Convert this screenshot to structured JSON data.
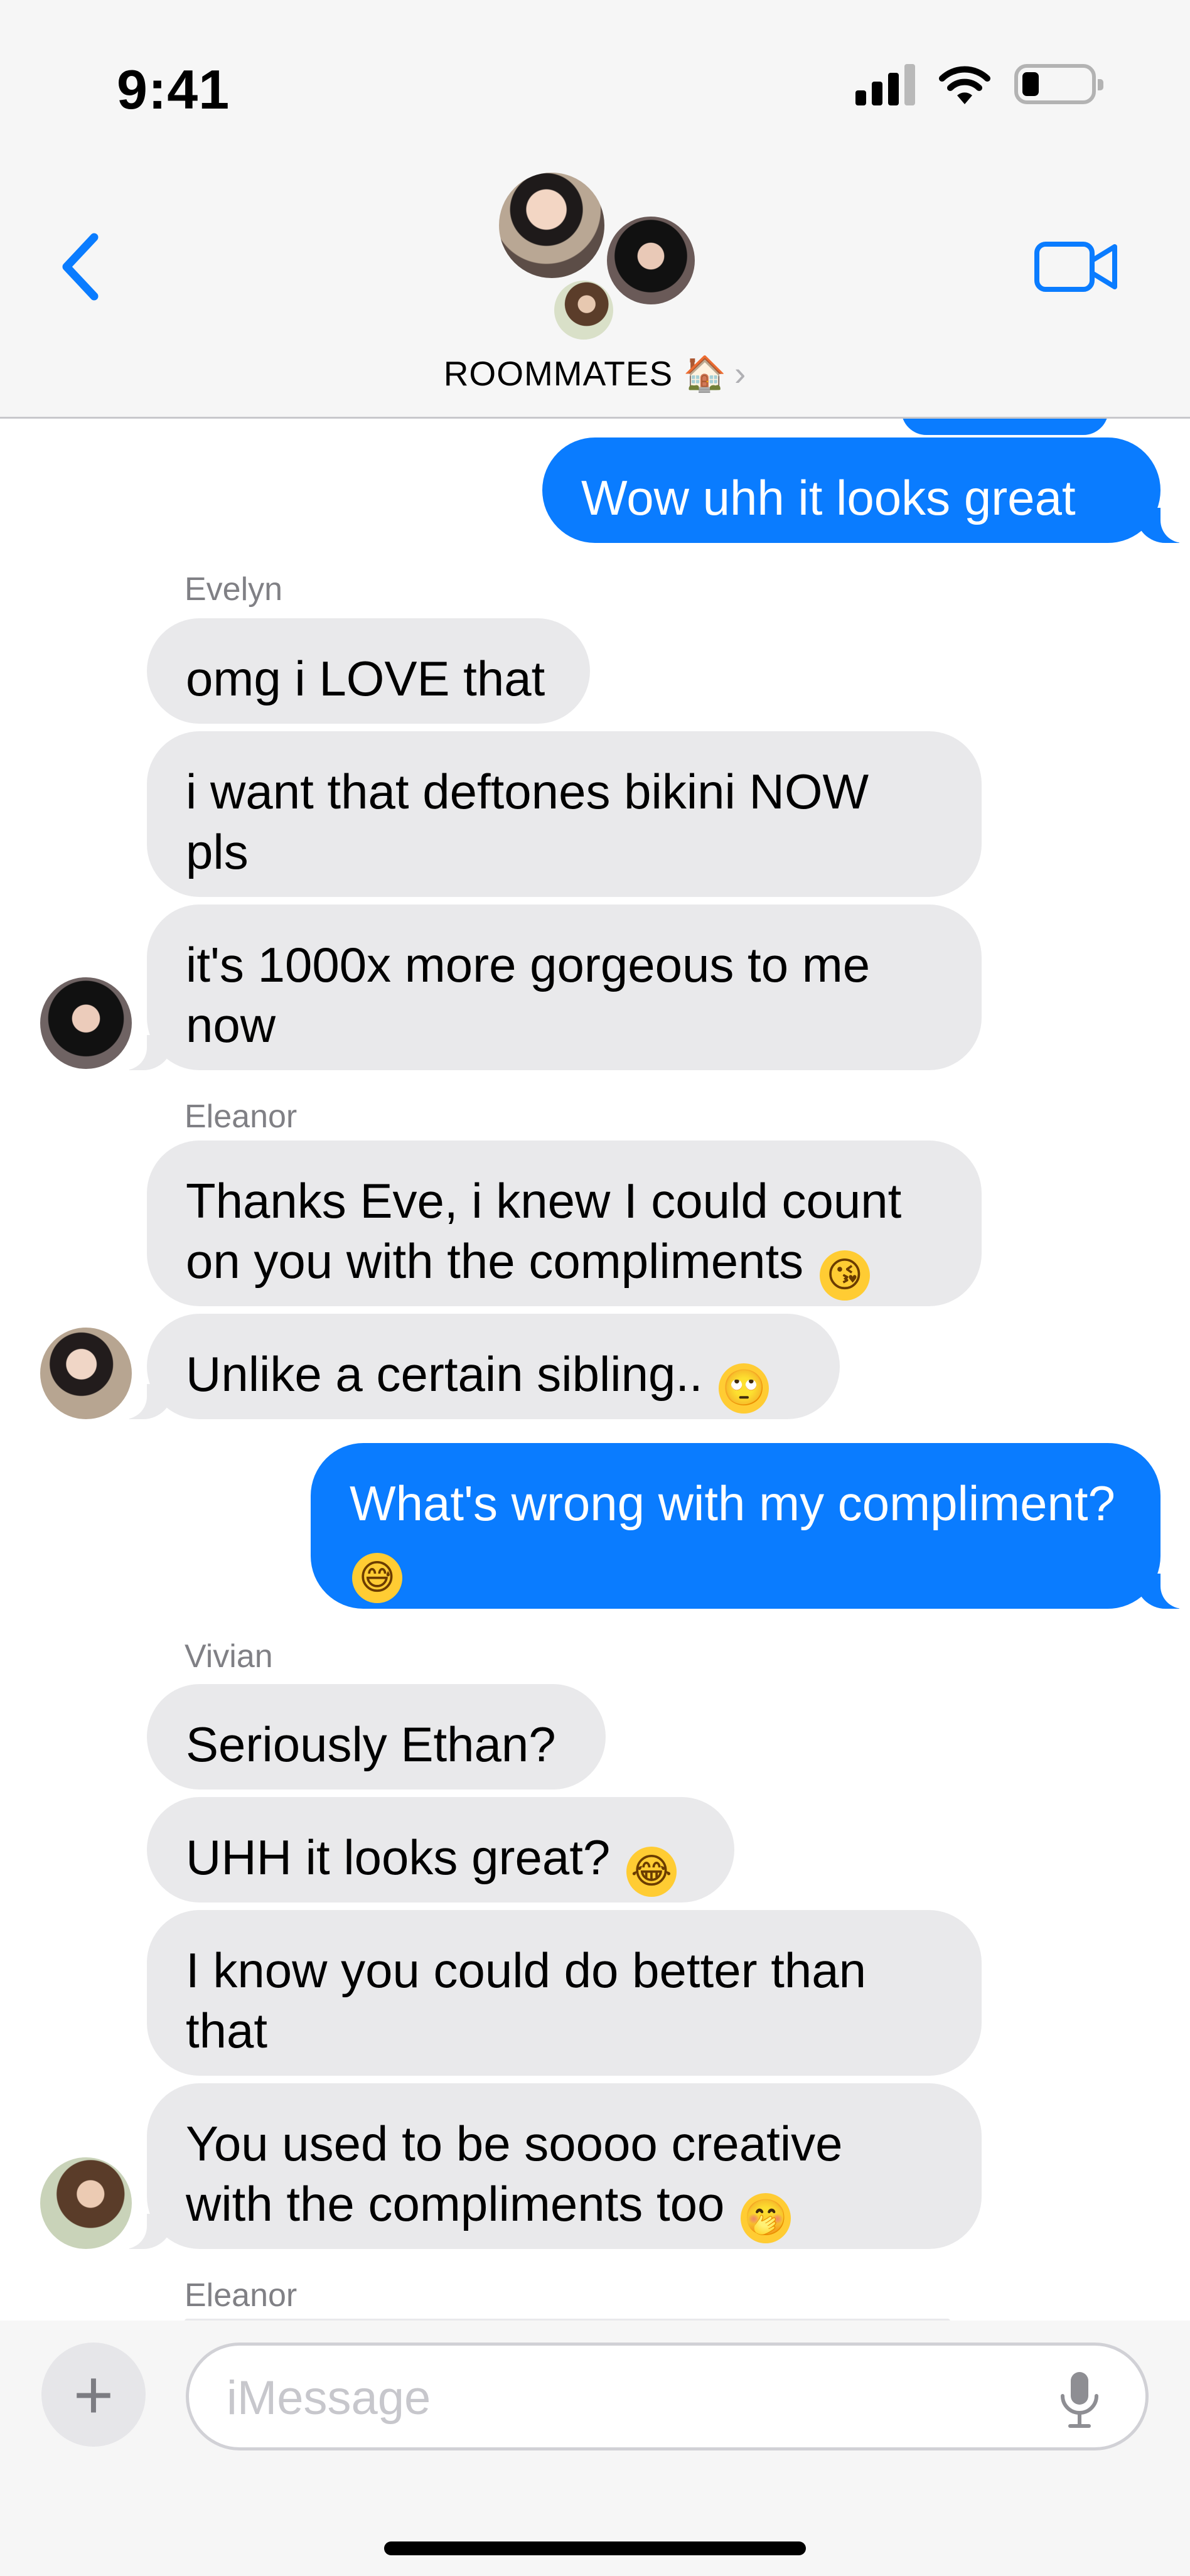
{
  "status_bar": {
    "time": "9:41"
  },
  "header": {
    "group_name": "ROOMMATES 🏠",
    "chevron": "›",
    "back_icon": "chevron-left-icon",
    "video_icon": "video-camera-icon"
  },
  "colors": {
    "outgoing": "#0a7cff",
    "incoming": "#e9e9eb",
    "accent": "#0a7cff"
  },
  "messages": [
    {
      "dir": "out",
      "text": "Wow uhh it looks great"
    },
    {
      "sender": "Evelyn"
    },
    {
      "dir": "in",
      "text": "omg i LOVE that"
    },
    {
      "dir": "in",
      "text": "i want that deftones bikini NOW pls"
    },
    {
      "dir": "in",
      "text": "it's 1000x more gorgeous to me now"
    },
    {
      "sender": "Eleanor"
    },
    {
      "dir": "in",
      "text": "Thanks Eve, i knew I could count on you with the compliments",
      "emoji": "kissing-face"
    },
    {
      "dir": "in",
      "text": "Unlike a certain sibling..",
      "emoji": "eye-roll-face"
    },
    {
      "dir": "out",
      "text": "What's wrong with my compliment?",
      "emoji": "sweat-smile-face"
    },
    {
      "sender": "Vivian"
    },
    {
      "dir": "in",
      "text": "Seriously Ethan?"
    },
    {
      "dir": "in",
      "text": "UHH it looks great?",
      "emoji": "tears-of-joy-face"
    },
    {
      "dir": "in",
      "text": "I know you could do better than that"
    },
    {
      "dir": "in",
      "text": "You used to be soooo creative with the compliments too",
      "emoji": "hand-over-mouth-face"
    },
    {
      "sender": "Eleanor"
    }
  ],
  "input": {
    "placeholder": "iMessage",
    "plus": "+"
  }
}
